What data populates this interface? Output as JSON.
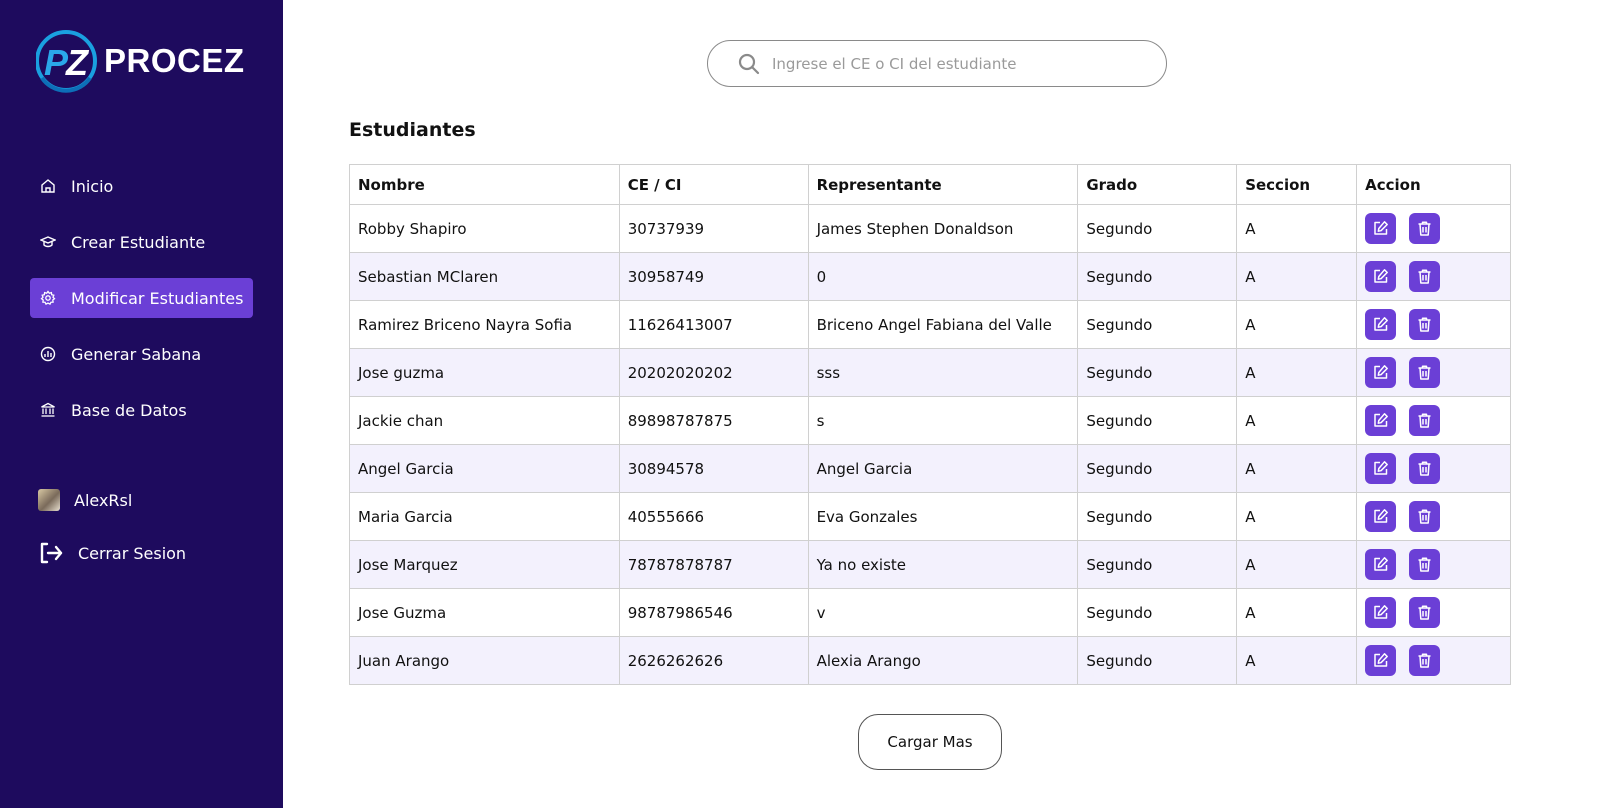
{
  "brand": {
    "name": "PROCEZ",
    "mark": "PZ"
  },
  "sidebar": {
    "items": [
      {
        "label": "Inicio",
        "icon": "home-icon"
      },
      {
        "label": "Crear Estudiante",
        "icon": "graduation-cap-icon"
      },
      {
        "label": "Modificar Estudiantes",
        "icon": "gear-icon",
        "active": true
      },
      {
        "label": "Generar Sabana",
        "icon": "chart-icon"
      },
      {
        "label": "Base de Datos",
        "icon": "bank-icon"
      }
    ],
    "user": {
      "name": "AlexRsl"
    },
    "logout_label": "Cerrar Sesion"
  },
  "search": {
    "placeholder": "Ingrese el CE o CI del estudiante",
    "value": ""
  },
  "page": {
    "title": "Estudiantes"
  },
  "table": {
    "headers": [
      "Nombre",
      "CE / CI",
      "Representante",
      "Grado",
      "Seccion",
      "Accion"
    ],
    "rows": [
      [
        "Robby Shapiro",
        "30737939",
        "James Stephen Donaldson",
        "Segundo",
        "A"
      ],
      [
        "Sebastian MClaren",
        "30958749",
        "0",
        "Segundo",
        "A"
      ],
      [
        "Ramirez Briceno Nayra Sofia",
        "11626413007",
        "Briceno Angel Fabiana del Valle",
        "Segundo",
        "A"
      ],
      [
        "Jose guzma",
        "20202020202",
        "sss",
        "Segundo",
        "A"
      ],
      [
        "Jackie chan",
        "89898787875",
        "s",
        "Segundo",
        "A"
      ],
      [
        "Angel Garcia",
        "30894578",
        "Angel Garcia",
        "Segundo",
        "A"
      ],
      [
        "Maria Garcia",
        "40555666",
        "Eva Gonzales",
        "Segundo",
        "A"
      ],
      [
        "Jose Marquez",
        "78787878787",
        "Ya no existe",
        "Segundo",
        "A"
      ],
      [
        "Jose Guzma",
        "98787986546",
        "v",
        "Segundo",
        "A"
      ],
      [
        "Juan Arango",
        "2626262626",
        "Alexia Arango",
        "Segundo",
        "A"
      ]
    ]
  },
  "load_more_label": "Cargar Mas",
  "colors": {
    "sidebar": "#1e0b5e",
    "accent": "#6b3fd6",
    "row_alt": "#f3f1fd"
  }
}
